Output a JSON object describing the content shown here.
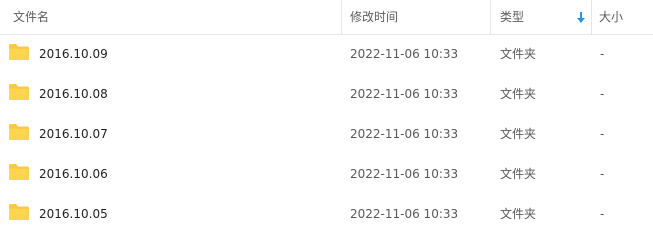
{
  "header": {
    "name_label": "文件名",
    "modified_label": "修改时间",
    "type_label": "类型",
    "size_label": "大小",
    "sort_icon": "sort-down-arrow",
    "sort_color": "#1a9af0"
  },
  "folder_color": "#ffcb3d",
  "files": [
    {
      "name": "2016.10.09",
      "modified": "2022-11-06 10:33",
      "type": "文件夹",
      "size": "-"
    },
    {
      "name": "2016.10.08",
      "modified": "2022-11-06 10:33",
      "type": "文件夹",
      "size": "-"
    },
    {
      "name": "2016.10.07",
      "modified": "2022-11-06 10:33",
      "type": "文件夹",
      "size": "-"
    },
    {
      "name": "2016.10.06",
      "modified": "2022-11-06 10:33",
      "type": "文件夹",
      "size": "-"
    },
    {
      "name": "2016.10.05",
      "modified": "2022-11-06 10:33",
      "type": "文件夹",
      "size": "-"
    }
  ]
}
